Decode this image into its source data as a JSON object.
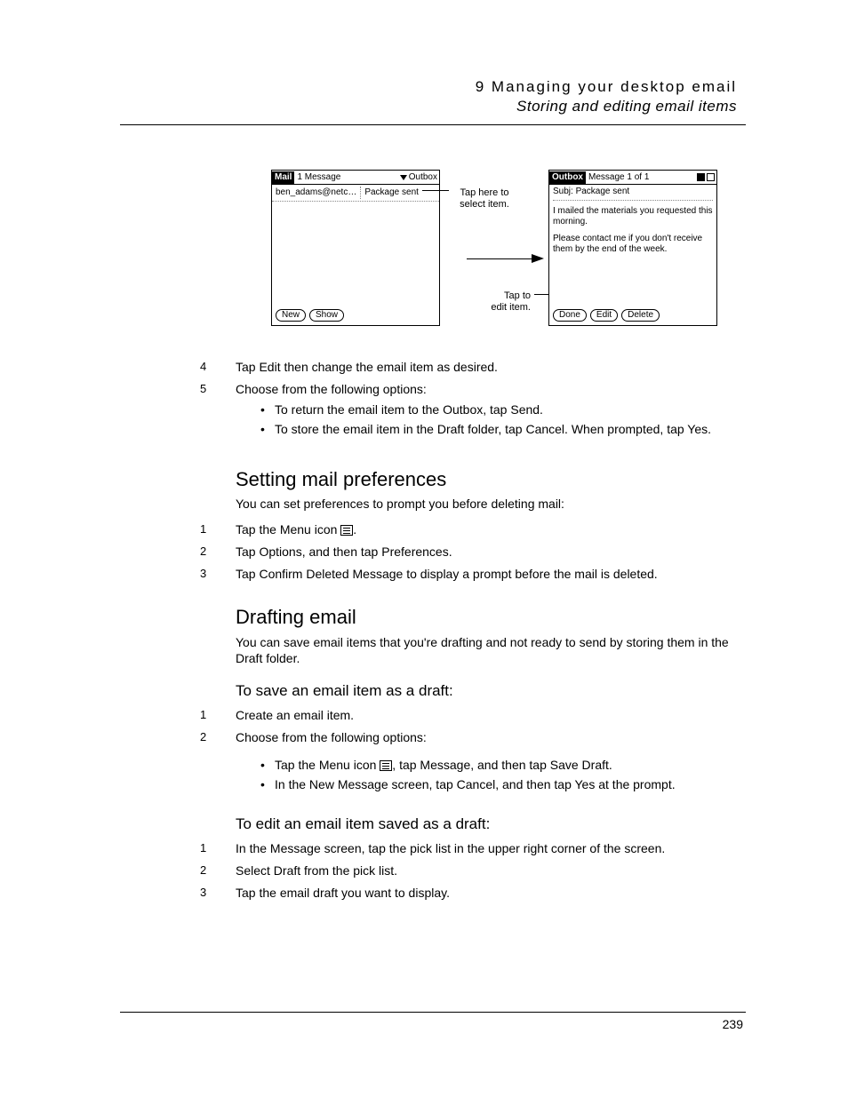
{
  "header": {
    "chapter": "9 Managing your desktop email",
    "section": "Storing and editing email items"
  },
  "figure": {
    "left_screen": {
      "title_chip": "Mail",
      "title_text": "1 Message",
      "dropdown": "Outbox",
      "row_from": "ben_adams@netc…",
      "row_subj": "Package sent",
      "btn_new": "New",
      "btn_show": "Show"
    },
    "callouts": {
      "top": "Tap here to select item.",
      "bottom": "Tap to edit item."
    },
    "right_screen": {
      "title_chip": "Outbox",
      "title_text": "Message 1 of 1",
      "subj_label": "Subj:",
      "subj_value": "Package sent",
      "body1": "I mailed the materials you requested this morning.",
      "body2": "Please contact me if you don't receive them by the end of the week.",
      "btn_done": "Done",
      "btn_edit": "Edit",
      "btn_delete": "Delete"
    }
  },
  "steps_a": {
    "s4": "Tap Edit then change the email item as desired.",
    "s5": "Choose from the following options:",
    "s5_b1": "To return the email item to the Outbox, tap Send.",
    "s5_b2": "To store the email item in the Draft folder, tap Cancel. When prompted, tap Yes."
  },
  "sec_prefs": {
    "heading": "Setting mail preferences",
    "intro": "You can set preferences to prompt you before deleting mail:",
    "s1a": "Tap the Menu icon ",
    "s1b": ".",
    "s2": "Tap Options, and then tap Preferences.",
    "s3": "Tap Confirm Deleted Message to display a prompt before the mail is deleted."
  },
  "sec_draft": {
    "heading": "Drafting email",
    "intro": "You can save email items that you're drafting and not ready to send by storing them in the Draft folder.",
    "sub_save": "To save an email item as a draft:",
    "save_s1": "Create an email item.",
    "save_s2": "Choose from the following options:",
    "save_b1a": "Tap the Menu icon ",
    "save_b1b": ", tap Message, and then tap Save Draft.",
    "save_b2": "In the New Message screen, tap Cancel, and then tap Yes at the prompt.",
    "sub_edit": "To edit an email item saved as a draft:",
    "edit_s1": "In the Message screen, tap the pick list in the upper right corner of the screen.",
    "edit_s2": "Select Draft from the pick list.",
    "edit_s3": "Tap the email draft you want to display."
  },
  "page_number": "239"
}
